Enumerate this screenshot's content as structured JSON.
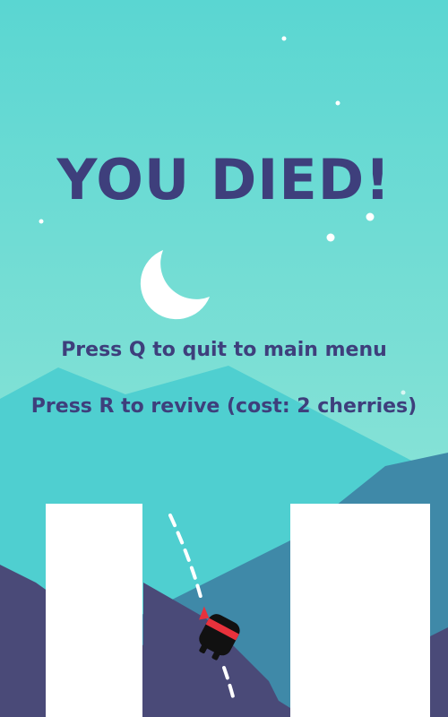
{
  "game_over": {
    "title": "YOU DIED!",
    "quit_hint": "Press Q to quit to main menu",
    "revive_hint": "Press R to revive (cost: 2 cherries)"
  },
  "scene": {
    "night_icon": "crescent-moon-icon",
    "player_icon": "ninja-hero-icon"
  },
  "colors": {
    "sky_top": "#5ad6d2",
    "sky_bottom": "#9ce8d8",
    "text": "#3e3f7c",
    "mountain_far": "#4fcfd0",
    "mountain_mid": "#3f89a8",
    "mountain_near": "#4a4a78",
    "platform": "#ffffff",
    "hero_body": "#111111",
    "hero_headband": "#e8323c"
  }
}
